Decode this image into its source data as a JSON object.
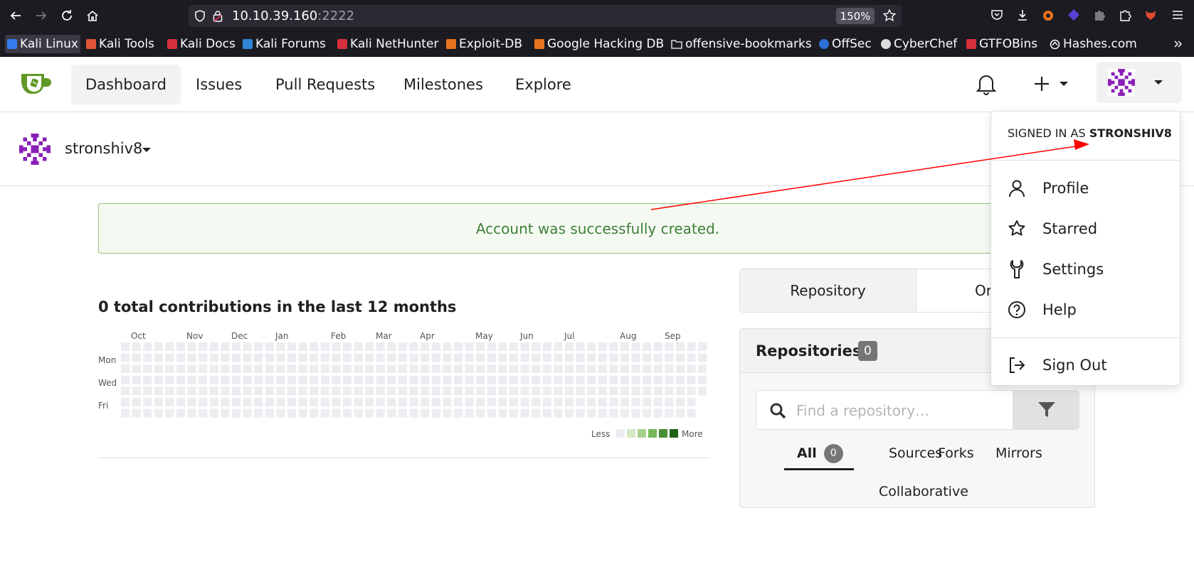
{
  "browser": {
    "url_host": "10.10.39.160",
    "url_port": ":2222",
    "zoom": "150%",
    "bookmarks": [
      {
        "label": "Kali Linux",
        "color": "#367bf0"
      },
      {
        "label": "Kali Tools",
        "color": "#e0553b"
      },
      {
        "label": "Kali Docs",
        "color": "#d6303c"
      },
      {
        "label": "Kali Forums",
        "color": "#2f86d6"
      },
      {
        "label": "Kali NetHunter",
        "color": "#d6303c"
      },
      {
        "label": "Exploit-DB",
        "color": "#e8731f"
      },
      {
        "label": "Google Hacking DB",
        "color": "#e8731f"
      },
      {
        "label": "offensive-bookmarks",
        "color": "#fbfbfe"
      },
      {
        "label": "OffSec",
        "color": "#2f6fd6"
      },
      {
        "label": "CyberChef",
        "color": "#dddddd"
      },
      {
        "label": "GTFOBins",
        "color": "#d6303c"
      },
      {
        "label": "Hashes.com",
        "color": "#fbfbfe"
      }
    ]
  },
  "header": {
    "nav": [
      "Dashboard",
      "Issues",
      "Pull Requests",
      "Milestones",
      "Explore"
    ],
    "accent": "#609926"
  },
  "context": {
    "username": "stronshiv8"
  },
  "flash": {
    "message": "Account was successfully created."
  },
  "heatmap": {
    "title": "0 total contributions in the last 12 months",
    "months": [
      "Oct",
      "Nov",
      "Dec",
      "Jan",
      "Feb",
      "Mar",
      "Apr",
      "May",
      "Jun",
      "Jul",
      "Aug",
      "Sep"
    ],
    "days": [
      "Mon",
      "Wed",
      "Fri"
    ],
    "legend_less": "Less",
    "legend_more": "More",
    "legend_colors": [
      "#ebedf0",
      "#d6e8c3",
      "#a7d18a",
      "#75b95a",
      "#4a8f33",
      "#1f5f16"
    ],
    "total_contributions": 0
  },
  "dashboard": {
    "tabs": [
      "Repository",
      "Orga"
    ],
    "repos_title": "Repositories",
    "repos_count": "0",
    "search_placeholder": "Find a repository…",
    "subtabs": {
      "all": "All",
      "all_count": "0",
      "sources": "Sources",
      "forks": "Forks",
      "mirrors": "Mirrors",
      "collaborative": "Collaborative"
    }
  },
  "dropdown": {
    "signed_in_prefix": "SIGNED IN AS",
    "signed_in_user": "STRONSHIV8",
    "items": [
      "Profile",
      "Starred",
      "Settings",
      "Help"
    ],
    "sign_out": "Sign Out"
  },
  "annotation": {
    "color": "#ff0000"
  }
}
